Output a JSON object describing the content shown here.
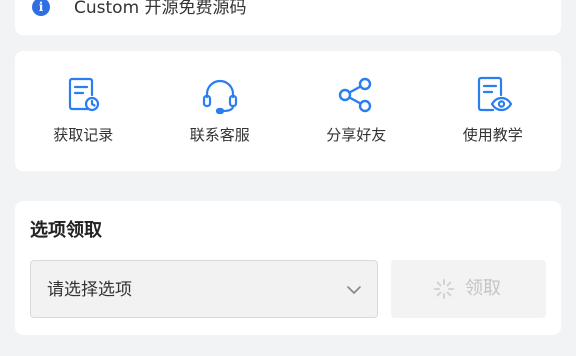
{
  "notice": {
    "text": "Custom 开源免费源码",
    "icon": "info-icon"
  },
  "actions": [
    {
      "label": "获取记录",
      "icon": "document-clock-icon"
    },
    {
      "label": "联系客服",
      "icon": "headset-icon"
    },
    {
      "label": "分享好友",
      "icon": "share-icon"
    },
    {
      "label": "使用教学",
      "icon": "document-eye-icon"
    }
  ],
  "claim": {
    "title": "选项领取",
    "select_placeholder": "请选择选项",
    "button_label": "领取",
    "button_icon": "loading-icon"
  },
  "colors": {
    "accent": "#2a7ef0",
    "info": "#2f6fe4",
    "page_bg": "#f2f3f5",
    "card_bg": "#ffffff",
    "disabled_text": "#c4c4c4"
  }
}
